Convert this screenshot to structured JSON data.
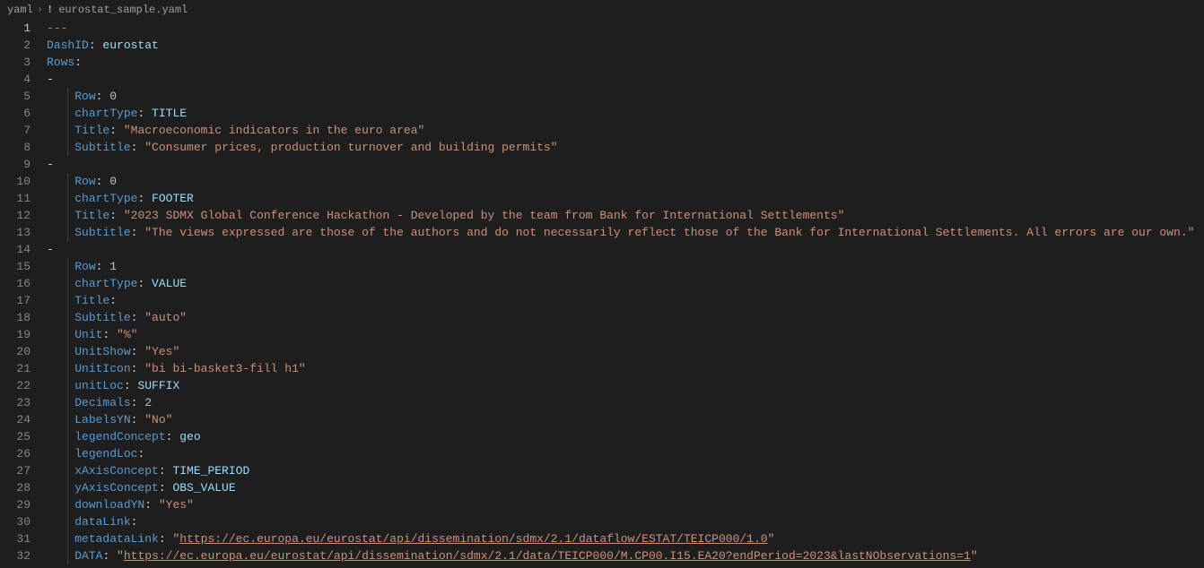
{
  "breadcrumb": {
    "folder": "yaml",
    "file": "eurostat_sample.yaml"
  },
  "gutter": {
    "current": 1,
    "count": 32
  },
  "lines": [
    {
      "indent": 0,
      "tokens": [
        {
          "cls": "doc-start",
          "t": "---"
        }
      ]
    },
    {
      "indent": 0,
      "tokens": [
        {
          "cls": "y-key",
          "t": "DashID"
        },
        {
          "cls": "y-punc",
          "t": ": "
        },
        {
          "cls": "y-plain",
          "t": "eurostat"
        }
      ]
    },
    {
      "indent": 0,
      "tokens": [
        {
          "cls": "y-key",
          "t": "Rows"
        },
        {
          "cls": "y-punc",
          "t": ":"
        }
      ]
    },
    {
      "indent": 0,
      "tokens": [
        {
          "cls": "y-dash",
          "t": "-"
        }
      ]
    },
    {
      "indent": 4,
      "guides": [
        3
      ],
      "tokens": [
        {
          "cls": "y-key",
          "t": "Row"
        },
        {
          "cls": "y-punc",
          "t": ": "
        },
        {
          "cls": "y-num",
          "t": "0"
        }
      ]
    },
    {
      "indent": 4,
      "guides": [
        3
      ],
      "tokens": [
        {
          "cls": "y-key",
          "t": "chartType"
        },
        {
          "cls": "y-punc",
          "t": ": "
        },
        {
          "cls": "y-plain",
          "t": "TITLE"
        }
      ]
    },
    {
      "indent": 4,
      "guides": [
        3
      ],
      "tokens": [
        {
          "cls": "y-key",
          "t": "Title"
        },
        {
          "cls": "y-punc",
          "t": ": "
        },
        {
          "cls": "y-str",
          "t": "\"Macroeconomic indicators in the euro area\""
        }
      ]
    },
    {
      "indent": 4,
      "guides": [
        3
      ],
      "tokens": [
        {
          "cls": "y-key",
          "t": "Subtitle"
        },
        {
          "cls": "y-punc",
          "t": ": "
        },
        {
          "cls": "y-str",
          "t": "\"Consumer prices, production turnover and building permits\""
        }
      ]
    },
    {
      "indent": 0,
      "tokens": [
        {
          "cls": "y-dash",
          "t": "-"
        }
      ]
    },
    {
      "indent": 4,
      "guides": [
        3
      ],
      "tokens": [
        {
          "cls": "y-key",
          "t": "Row"
        },
        {
          "cls": "y-punc",
          "t": ": "
        },
        {
          "cls": "y-num",
          "t": "0"
        }
      ]
    },
    {
      "indent": 4,
      "guides": [
        3
      ],
      "tokens": [
        {
          "cls": "y-key",
          "t": "chartType"
        },
        {
          "cls": "y-punc",
          "t": ": "
        },
        {
          "cls": "y-plain",
          "t": "FOOTER"
        }
      ]
    },
    {
      "indent": 4,
      "guides": [
        3
      ],
      "tokens": [
        {
          "cls": "y-key",
          "t": "Title"
        },
        {
          "cls": "y-punc",
          "t": ": "
        },
        {
          "cls": "y-str",
          "t": "\"2023 SDMX Global Conference Hackathon - Developed by the team from Bank for International Settlements\""
        }
      ]
    },
    {
      "indent": 4,
      "guides": [
        3
      ],
      "tokens": [
        {
          "cls": "y-key",
          "t": "Subtitle"
        },
        {
          "cls": "y-punc",
          "t": ": "
        },
        {
          "cls": "y-str",
          "t": "\"The views expressed are those of the authors and do not necessarily reflect those of the Bank for International Settlements. All errors are our own.\""
        }
      ]
    },
    {
      "indent": 0,
      "tokens": [
        {
          "cls": "y-dash",
          "t": "-"
        }
      ]
    },
    {
      "indent": 4,
      "guides": [
        3
      ],
      "tokens": [
        {
          "cls": "y-key",
          "t": "Row"
        },
        {
          "cls": "y-punc",
          "t": ": "
        },
        {
          "cls": "y-num",
          "t": "1"
        }
      ]
    },
    {
      "indent": 4,
      "guides": [
        3
      ],
      "tokens": [
        {
          "cls": "y-key",
          "t": "chartType"
        },
        {
          "cls": "y-punc",
          "t": ": "
        },
        {
          "cls": "y-plain",
          "t": "VALUE"
        }
      ]
    },
    {
      "indent": 4,
      "guides": [
        3
      ],
      "tokens": [
        {
          "cls": "y-key",
          "t": "Title"
        },
        {
          "cls": "y-punc",
          "t": ":"
        }
      ]
    },
    {
      "indent": 4,
      "guides": [
        3
      ],
      "tokens": [
        {
          "cls": "y-key",
          "t": "Subtitle"
        },
        {
          "cls": "y-punc",
          "t": ": "
        },
        {
          "cls": "y-str",
          "t": "\"auto\""
        }
      ]
    },
    {
      "indent": 4,
      "guides": [
        3
      ],
      "tokens": [
        {
          "cls": "y-key",
          "t": "Unit"
        },
        {
          "cls": "y-punc",
          "t": ": "
        },
        {
          "cls": "y-str",
          "t": "\"%\""
        }
      ]
    },
    {
      "indent": 4,
      "guides": [
        3
      ],
      "tokens": [
        {
          "cls": "y-key",
          "t": "UnitShow"
        },
        {
          "cls": "y-punc",
          "t": ": "
        },
        {
          "cls": "y-str",
          "t": "\"Yes\""
        }
      ]
    },
    {
      "indent": 4,
      "guides": [
        3
      ],
      "tokens": [
        {
          "cls": "y-key",
          "t": "UnitIcon"
        },
        {
          "cls": "y-punc",
          "t": ": "
        },
        {
          "cls": "y-str",
          "t": "\"bi bi-basket3-fill h1\""
        }
      ]
    },
    {
      "indent": 4,
      "guides": [
        3
      ],
      "tokens": [
        {
          "cls": "y-key",
          "t": "unitLoc"
        },
        {
          "cls": "y-punc",
          "t": ": "
        },
        {
          "cls": "y-plain",
          "t": "SUFFIX"
        }
      ]
    },
    {
      "indent": 4,
      "guides": [
        3
      ],
      "tokens": [
        {
          "cls": "y-key",
          "t": "Decimals"
        },
        {
          "cls": "y-punc",
          "t": ": "
        },
        {
          "cls": "y-num",
          "t": "2"
        }
      ]
    },
    {
      "indent": 4,
      "guides": [
        3
      ],
      "tokens": [
        {
          "cls": "y-key",
          "t": "LabelsYN"
        },
        {
          "cls": "y-punc",
          "t": ": "
        },
        {
          "cls": "y-str",
          "t": "\"No\""
        }
      ]
    },
    {
      "indent": 4,
      "guides": [
        3
      ],
      "tokens": [
        {
          "cls": "y-key",
          "t": "legendConcept"
        },
        {
          "cls": "y-punc",
          "t": ": "
        },
        {
          "cls": "y-plain",
          "t": "geo"
        }
      ]
    },
    {
      "indent": 4,
      "guides": [
        3
      ],
      "tokens": [
        {
          "cls": "y-key",
          "t": "legendLoc"
        },
        {
          "cls": "y-punc",
          "t": ":"
        }
      ]
    },
    {
      "indent": 4,
      "guides": [
        3
      ],
      "tokens": [
        {
          "cls": "y-key",
          "t": "xAxisConcept"
        },
        {
          "cls": "y-punc",
          "t": ": "
        },
        {
          "cls": "y-plain",
          "t": "TIME_PERIOD"
        }
      ]
    },
    {
      "indent": 4,
      "guides": [
        3
      ],
      "tokens": [
        {
          "cls": "y-key",
          "t": "yAxisConcept"
        },
        {
          "cls": "y-punc",
          "t": ": "
        },
        {
          "cls": "y-plain",
          "t": "OBS_VALUE"
        }
      ]
    },
    {
      "indent": 4,
      "guides": [
        3
      ],
      "tokens": [
        {
          "cls": "y-key",
          "t": "downloadYN"
        },
        {
          "cls": "y-punc",
          "t": ": "
        },
        {
          "cls": "y-str",
          "t": "\"Yes\""
        }
      ]
    },
    {
      "indent": 4,
      "guides": [
        3
      ],
      "tokens": [
        {
          "cls": "y-key",
          "t": "dataLink"
        },
        {
          "cls": "y-punc",
          "t": ":"
        }
      ]
    },
    {
      "indent": 4,
      "guides": [
        3
      ],
      "tokens": [
        {
          "cls": "y-key",
          "t": "metadataLink"
        },
        {
          "cls": "y-punc",
          "t": ": "
        },
        {
          "cls": "y-str",
          "t": "\""
        },
        {
          "cls": "y-url",
          "t": "https://ec.europa.eu/eurostat/api/dissemination/sdmx/2.1/dataflow/ESTAT/TEICP000/1.0"
        },
        {
          "cls": "y-str",
          "t": "\""
        }
      ]
    },
    {
      "indent": 4,
      "guides": [
        3
      ],
      "tokens": [
        {
          "cls": "y-key",
          "t": "DATA"
        },
        {
          "cls": "y-punc",
          "t": ": "
        },
        {
          "cls": "y-str",
          "t": "\""
        },
        {
          "cls": "y-url",
          "t": "https://ec.europa.eu/eurostat/api/dissemination/sdmx/2.1/data/TEICP000/M.CP00.I15.EA20?endPeriod=2023&lastNObservations=1"
        },
        {
          "cls": "y-str",
          "t": "\""
        }
      ]
    }
  ]
}
